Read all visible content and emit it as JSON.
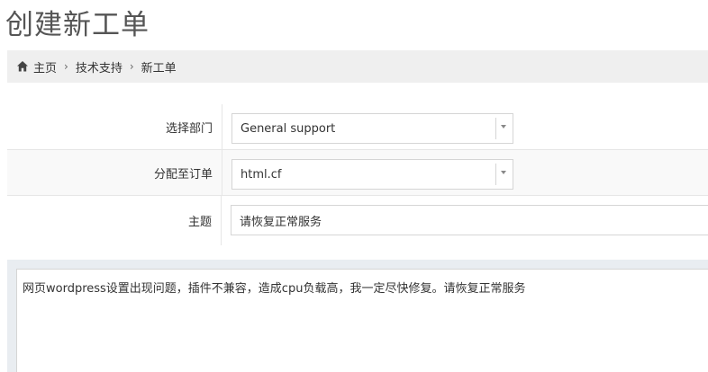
{
  "page": {
    "title": "创建新工单"
  },
  "breadcrumb": {
    "home_icon": "home-icon",
    "items": [
      "主页",
      "技术支持",
      "新工单"
    ],
    "separator": "›"
  },
  "form": {
    "department": {
      "label": "选择部门",
      "value": "General support"
    },
    "order": {
      "label": "分配至订单",
      "value": "html.cf"
    },
    "subject": {
      "label": "主题",
      "value": "请恢复正常服务"
    },
    "message": {
      "value": "网页wordpress设置出现问题，插件不兼容，造成cpu负载高，我一定尽快修复。请恢复正常服务"
    }
  },
  "colors": {
    "breadcrumb_bg": "#efefef",
    "editor_bg": "#e9edf1",
    "border": "#d5d5d5"
  }
}
